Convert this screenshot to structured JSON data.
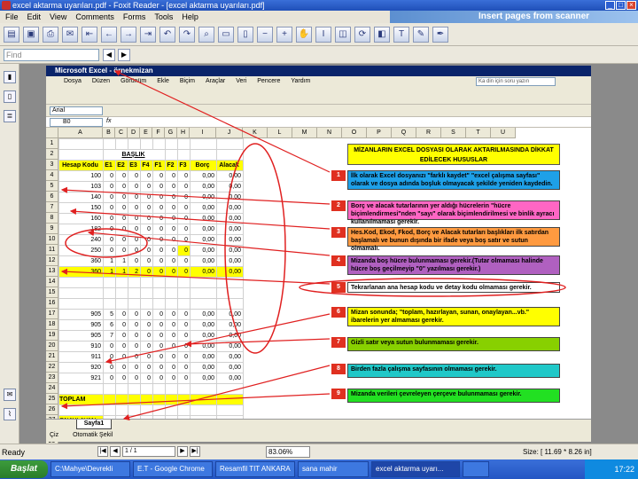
{
  "window": {
    "title": "excel aktarma uyarıları.pdf - Foxit Reader - [excel aktarma uyarıları.pdf]",
    "banner_text": "Insert pages from scanner"
  },
  "menu": [
    "File",
    "Edit",
    "View",
    "Comments",
    "Forms",
    "Tools",
    "Help"
  ],
  "find": {
    "placeholder": "Find"
  },
  "excel": {
    "title": "Microsoft Excel - örnekmizan",
    "menu": [
      "Dosya",
      "Düzen",
      "Görünüm",
      "Ekle",
      "Biçim",
      "Araçlar",
      "Veri",
      "Pencere",
      "Yardım"
    ],
    "help_placeholder": "Ka din için soru yazın",
    "font": "Arial",
    "cell_ref": "B0",
    "fx": "fx",
    "columns": [
      "A",
      "B",
      "C",
      "D",
      "E",
      "F",
      "G",
      "H",
      "I",
      "J",
      "K",
      "L",
      "M",
      "N",
      "O",
      "P",
      "Q",
      "R",
      "S",
      "T",
      "U"
    ],
    "rows": [
      "1",
      "2",
      "3",
      "4",
      "5",
      "6",
      "7",
      "8",
      "9",
      "10",
      "11",
      "12",
      "13",
      "14",
      "15",
      "16",
      "17",
      "18",
      "19",
      "20",
      "21",
      "22",
      "23",
      "24",
      "25",
      "26",
      "27",
      "28",
      "29",
      "30",
      "31",
      "32",
      "33"
    ],
    "sheet_tab": "Sayfa1",
    "draw_label": "Çiz",
    "autoshapes": "Otomatik Şekil",
    "table": {
      "heading": "BAŞLIK",
      "header": [
        "Hesap Kodu",
        "E1",
        "E2",
        "E3",
        "F4",
        "F1",
        "F2",
        "F3",
        "Borç",
        "Alacak"
      ],
      "rows": [
        [
          "100",
          "0",
          "0",
          "0",
          "0",
          "0",
          "0",
          "0",
          "0,00",
          "0,00"
        ],
        [
          "103",
          "0",
          "0",
          "0",
          "0",
          "0",
          "0",
          "0",
          "0,00",
          "0,00"
        ],
        [
          "140",
          "0",
          "0",
          "0",
          "0",
          "0",
          "0",
          "0",
          "0,00",
          "0,00"
        ],
        [
          "150",
          "0",
          "0",
          "0",
          "0",
          "0",
          "0",
          "0",
          "0,00",
          "0,00"
        ],
        [
          "160",
          "0",
          "0",
          "0",
          "0",
          "0",
          "0",
          "0",
          "0,00",
          "0,00"
        ],
        [
          "182",
          "0",
          "0",
          "0",
          "0",
          "0",
          "0",
          "0",
          "0,00",
          "0,00"
        ],
        [
          "240",
          "0",
          "0",
          "0",
          "0",
          "0",
          "0",
          "0",
          "0,00",
          "0,00"
        ],
        [
          "250",
          "0",
          "0",
          "0",
          "0",
          "0",
          "0",
          "0",
          "0,00",
          "0,00"
        ],
        [
          "360",
          "1",
          "1",
          "0",
          "0",
          "0",
          "0",
          "0",
          "0,00",
          "0,00"
        ],
        [
          "360",
          "1",
          "1",
          "2",
          "0",
          "0",
          "0",
          "0",
          "0,00",
          "0,00"
        ],
        [
          "",
          "",
          "",
          "",
          "",
          "",
          "",
          "",
          "",
          ""
        ],
        [
          "",
          "",
          "",
          "",
          "",
          "",
          "",
          "",
          "",
          ""
        ],
        [
          "",
          "",
          "",
          "",
          "",
          "",
          "",
          "",
          "",
          ""
        ],
        [
          "905",
          "5",
          "0",
          "0",
          "0",
          "0",
          "0",
          "0",
          "0,00",
          "0,00"
        ],
        [
          "905",
          "6",
          "0",
          "0",
          "0",
          "0",
          "0",
          "0",
          "0,00",
          "0,00"
        ],
        [
          "905",
          "7",
          "0",
          "0",
          "0",
          "0",
          "0",
          "0",
          "0,00",
          "0,00"
        ],
        [
          "910",
          "0",
          "0",
          "0",
          "0",
          "0",
          "0",
          "0",
          "0,00",
          "0,00"
        ],
        [
          "911",
          "0",
          "0",
          "0",
          "0",
          "0",
          "0",
          "0",
          "0,00",
          "0,00"
        ],
        [
          "920",
          "0",
          "0",
          "0",
          "0",
          "0",
          "0",
          "0",
          "0,00",
          "0,00"
        ],
        [
          "921",
          "0",
          "0",
          "0",
          "0",
          "0",
          "0",
          "0",
          "0,00",
          "0,00"
        ],
        [
          "",
          "",
          "",
          "",
          "",
          "",
          "",
          "",
          "",
          ""
        ]
      ],
      "total_label": "TOPLAM",
      "approved_label": "ONAYLAYAN",
      "prepared_label": "HAZIRLAYAN"
    }
  },
  "notes": {
    "title": "MİZANLARIN EXCEL DOSYASI OLARAK AKTARILMASINDA DİKKAT EDİLECEK HUSUSLAR",
    "items": [
      {
        "num": "1",
        "color": "#1ea0e8",
        "text": "İlk olarak Excel dosyanızı \"farklı kaydet\" \"excel çalışma sayfası\" olarak ve dosya adında boşluk olmayacak şekilde yeniden kaydedin."
      },
      {
        "num": "2",
        "color": "#ff66c4",
        "text": "Borç ve alacak tutarlarının yer aldığı hücrelerin \"hücre biçimlendirmesi\"nden \"sayı\" olarak biçimlendirilmesi ve binlik ayracı kullanılmaması gerekir."
      },
      {
        "num": "3",
        "color": "#ff9a40",
        "text": "Hes.Kod, Ekod, Fkod, Borç ve Alacak tutarları başlıkları ilk satırdan başlamalı ve bunun dışında bir ifade veya boş satır ve sutun olmamalı."
      },
      {
        "num": "4",
        "color": "#b060c0",
        "text": "Mizanda boş hücre bulunmaması gerekir.(Tutar olmaması halinde hücre boş geçilmeyip \"0\" yazılması gerekir.)"
      },
      {
        "num": "5",
        "color": "#ffffff",
        "text": "Tekrarlanan ana hesap kodu ve detay kodu olmaması gerekir."
      },
      {
        "num": "6",
        "color": "#ffff00",
        "text": "Mizan sonunda; \"toplam, hazırlayan, sunan, onaylayan...vb.\" ibarelerin yer almaması gerekir."
      },
      {
        "num": "7",
        "color": "#88d000",
        "text": "Gizli satır veya sutun bulunmaması gerekir."
      },
      {
        "num": "8",
        "color": "#20c8c8",
        "text": "Birden fazla çalışma sayfasının olmaması gerekir."
      },
      {
        "num": "9",
        "color": "#22e022",
        "text": "Mizanda verileri çevreleyen çerçeve bulunmaması gerekir."
      }
    ]
  },
  "status": {
    "ready": "Ready",
    "page": "1 / 1",
    "zoom": "83.06%",
    "size": "Size: [ 11.69 * 8.26 in]"
  },
  "taskbar": {
    "start": "Başlat",
    "tasks": [
      "C:\\Mahye\\Devrekli",
      "E.T - Google Chrome",
      "Resamfil TIT ANKARA",
      "sana mahir",
      "excel aktarma uyarı...",
      ""
    ],
    "clock": "17:22"
  },
  "colors": {
    "accent_red": "#e02020",
    "note_title_bg": "#ffff00",
    "excel_titlebar": "#0a246a"
  }
}
